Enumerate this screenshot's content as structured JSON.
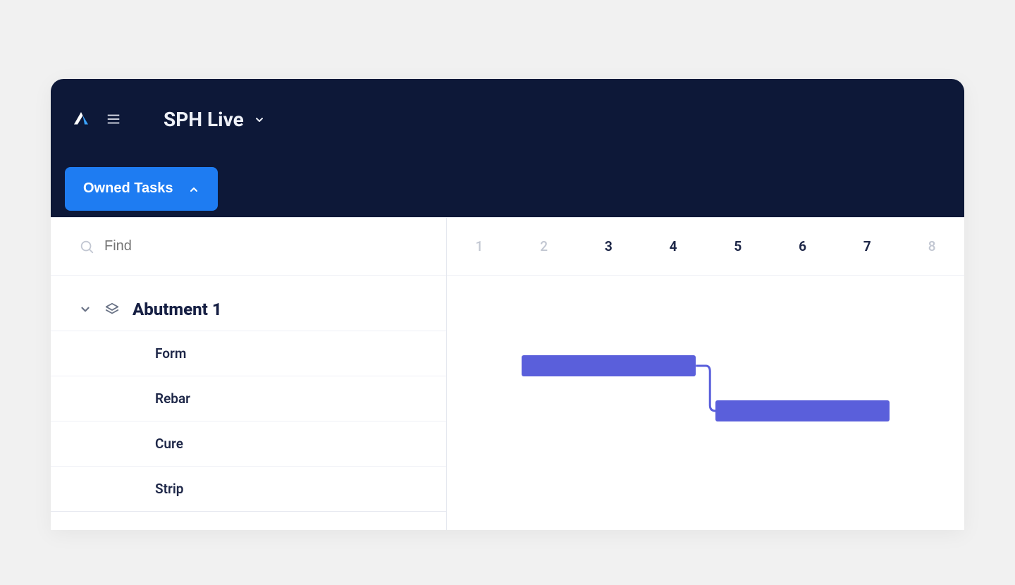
{
  "header": {
    "project_name": "SPH Live"
  },
  "filter": {
    "owned_tasks_label": "Owned Tasks"
  },
  "search": {
    "placeholder": "Find"
  },
  "timeline": {
    "days": [
      {
        "label": "1",
        "dim": true
      },
      {
        "label": "2",
        "dim": true
      },
      {
        "label": "3",
        "dim": false
      },
      {
        "label": "4",
        "dim": false
      },
      {
        "label": "5",
        "dim": false
      },
      {
        "label": "6",
        "dim": false
      },
      {
        "label": "7",
        "dim": false
      },
      {
        "label": "8",
        "dim": true
      }
    ]
  },
  "group": {
    "title": "Abutment 1",
    "tasks": [
      {
        "label": "Form",
        "start": 2,
        "end": 4,
        "has_bar": true
      },
      {
        "label": "Rebar",
        "start": 5,
        "end": 7,
        "has_bar": true,
        "depends_on": 0
      },
      {
        "label": "Cure",
        "has_bar": false
      },
      {
        "label": "Strip",
        "has_bar": false
      }
    ]
  },
  "colors": {
    "bar": "#5a5fdb",
    "accent": "#1e7cf2",
    "dark": "#0d1838"
  }
}
